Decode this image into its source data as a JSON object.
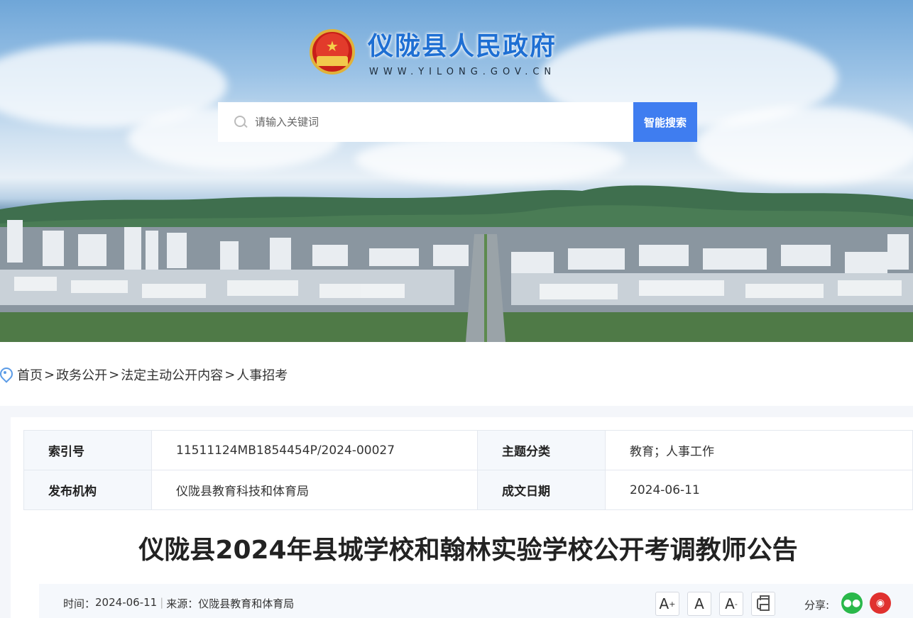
{
  "header": {
    "site_name": "仪陇县人民政府",
    "site_url": "WWW.YILONG.GOV.CN",
    "search": {
      "placeholder": "请输入关键词",
      "button_label": "智能搜索"
    }
  },
  "breadcrumb": {
    "items": [
      "首页",
      "政务公开",
      "法定主动公开内容",
      "人事招考"
    ],
    "separator": ">"
  },
  "meta": {
    "rows": [
      {
        "k1": "索引号",
        "v1": "11511124MB1854454P/2024-00027",
        "k2": "主题分类",
        "v2": "教育；人事工作"
      },
      {
        "k1": "发布机构",
        "v1": "仪陇县教育科技和体育局",
        "k2": "成文日期",
        "v2": "2024-06-11"
      }
    ]
  },
  "article": {
    "title": "仪陇县2024年县城学校和翰林实验学校公开考调教师公告",
    "time_label": "时间：",
    "time": "2024-06-11",
    "source_label": "来源：",
    "source": "仪陇县教育和体育局",
    "divider": "|"
  },
  "tools": {
    "font_large": "A",
    "font_medium": "A",
    "font_small": "A",
    "share_label": "分享:"
  },
  "colors": {
    "accent": "#3f7df0",
    "title_blue": "#1e6fd3",
    "wechat": "#2ab84a",
    "weibo": "#e0312f"
  }
}
